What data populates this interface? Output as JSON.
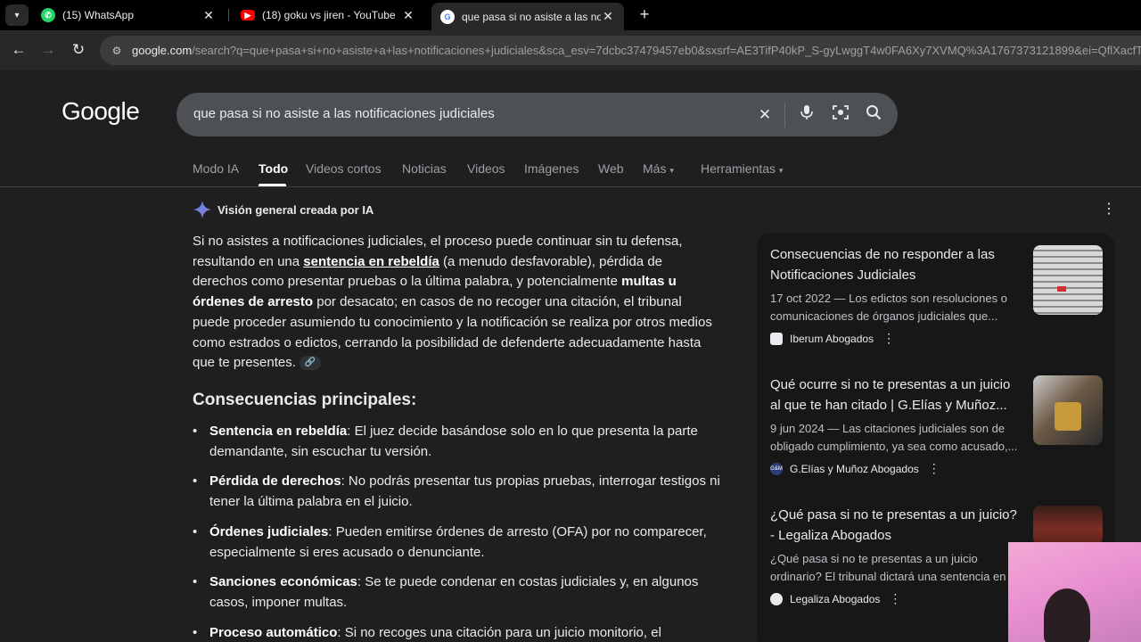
{
  "browser": {
    "tabs": [
      {
        "title": "(15) WhatsApp",
        "icon": "whatsapp-icon",
        "color": "#25d366"
      },
      {
        "title": "(18) goku vs jiren - YouTube",
        "icon": "youtube-icon",
        "color": "#ff0000"
      },
      {
        "title": "que pasa si no asiste a las notif",
        "icon": "google-icon",
        "color": "#ffffff"
      }
    ],
    "url_host": "google.com",
    "url_rest": "/search?q=que+pasa+si+no+asiste+a+las+notificaciones+judiciales&sca_esv=7dcbc37479457eb0&sxsrf=AE3TifP40kP_S-gyLwggT4w0FA6Xy7XVMQ%3A1767373121899&ei=QflXacfT"
  },
  "google": {
    "logo": "Google",
    "query": "que pasa si no asiste a las notificaciones judiciales",
    "nav": [
      "Modo IA",
      "Todo",
      "Videos cortos",
      "Noticias",
      "Videos",
      "Imágenes",
      "Web",
      "Más",
      "Herramientas"
    ]
  },
  "ai_overview": {
    "title": "Visión general creada por IA",
    "p1": "Si no asistes a notificaciones judiciales, el proceso puede continuar sin tu defensa, resultando en una ",
    "p1_link": "sentencia en rebeldía",
    "p2": " (a menudo desfavorable), pérdida de derechos como presentar pruebas o la última palabra, y potencialmente ",
    "p2_bold": "multas u órdenes de arresto",
    "p3": " por desacato; en casos de no recoger una citación, el tribunal puede proceder asumiendo tu conocimiento y la notificación se realiza por otros medios como estrados o edictos, cerrando la posibilidad de defenderte adecuadamente hasta que te presentes. ",
    "heading": "Consecuencias principales:",
    "bullets": [
      {
        "term": "Sentencia en rebeldía",
        "text": ": El juez decide basándose solo en lo que presenta la parte demandante, sin escuchar tu versión."
      },
      {
        "term": "Pérdida de derechos",
        "text": ": No podrás presentar tus propias pruebas, interrogar testigos ni tener la última palabra en el juicio."
      },
      {
        "term": "Órdenes judiciales",
        "text": ": Pueden emitirse órdenes de arresto (OFA) por no comparecer, especialmente si eres acusado o denunciante."
      },
      {
        "term": "Sanciones económicas",
        "text": ": Se te puede condenar en costas judiciales y, en algunos casos, imponer multas."
      },
      {
        "term": "Proceso automático",
        "text": ": Si no recoges una citación para un juicio monitorio, el"
      }
    ]
  },
  "sources": [
    {
      "title": "Consecuencias de no responder a las Notificaciones Judiciales",
      "snippet": "17 oct 2022 — Los edictos son resoluciones o comunicaciones de órganos judiciales que...",
      "site": "Iberum Abogados"
    },
    {
      "title": "Qué ocurre si no te presentas a un juicio al que te han citado | G.Elías y Muñoz...",
      "snippet": "9 jun 2024 — Las citaciones judiciales son de obligado cumplimiento, ya sea como acusado,...",
      "site": "G.Elías y Muñoz Abogados",
      "site_icon_text": "G&M"
    },
    {
      "title": "¿Qué pasa si no te presentas a un juicio? - Legaliza Abogados",
      "snippet": "¿Qué pasa si no te presentas a un juicio ordinario? El tribunal dictará una sentencia en",
      "site": "Legaliza Abogados"
    }
  ]
}
